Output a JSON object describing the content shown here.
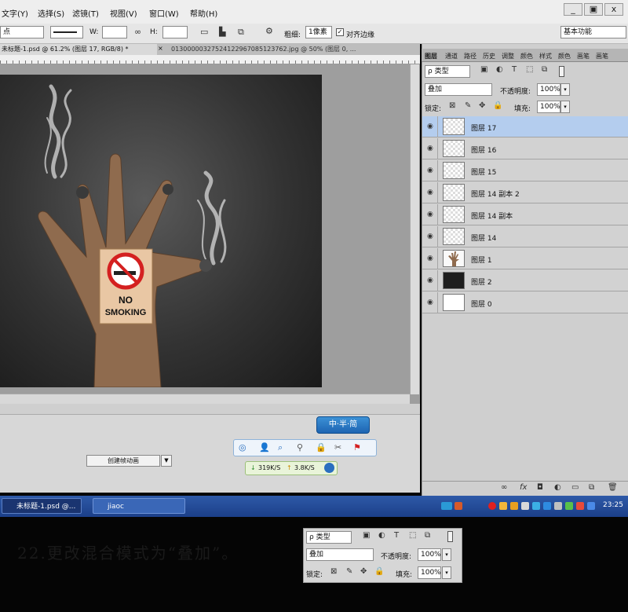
{
  "menu": {
    "items": [
      "文字(Y)",
      "选择(S)",
      "滤镜(T)",
      "视图(V)",
      "窗口(W)",
      "帮助(H)"
    ],
    "window_controls": [
      "_",
      "▣",
      "x"
    ]
  },
  "options_bar": {
    "unit_select": "点",
    "w_label": "W:",
    "h_label": "H:",
    "radius_label": "粗细:",
    "radius_value": "1像素",
    "align_edges_label": "对齐边缘",
    "workspace": "基本功能"
  },
  "tabs": {
    "active": "未标题-1.psd @ 61.2% (图层 17, RGB/8) *",
    "second": "0130000032752412296708512376​2.jpg @ 50% (图层 0, ..."
  },
  "timeline": {
    "create_label": "创建帧动画",
    "arrow": "▼"
  },
  "ime_label": "中·半·简",
  "netspeed": {
    "down": "319K/S",
    "up": "3.8K/S"
  },
  "panel": {
    "tabs": [
      "图层",
      "通道",
      "路径",
      "历史",
      "调整",
      "颜色",
      "样式",
      "颜色",
      "画笔",
      "画笔"
    ],
    "filter_label": "ρ 类型",
    "blend_mode": "叠加",
    "opacity_label": "不透明度:",
    "opacity_value": "100%",
    "lock_label": "锁定:",
    "fill_label": "填充:",
    "fill_value": "100%"
  },
  "layers": [
    {
      "name": "图层 17",
      "selected": true,
      "thumb": "transparent"
    },
    {
      "name": "图层 16",
      "selected": false,
      "thumb": "transparent"
    },
    {
      "name": "图层 15",
      "selected": false,
      "thumb": "transparent"
    },
    {
      "name": "图层 14 副本 2",
      "selected": false,
      "thumb": "transparent"
    },
    {
      "name": "图层 14 副本",
      "selected": false,
      "thumb": "transparent"
    },
    {
      "name": "图层 14",
      "selected": false,
      "thumb": "transparent"
    },
    {
      "name": "图层 1",
      "selected": false,
      "thumb": "hand"
    },
    {
      "name": "图层 2",
      "selected": false,
      "thumb": "dark"
    },
    {
      "name": "图层 0",
      "selected": false,
      "thumb": "white"
    }
  ],
  "sign": {
    "line1": "NO",
    "line2": "SMOKING"
  },
  "taskbar": {
    "task1": "未标题-1.psd @...",
    "task2": "jiaoc",
    "clock": "23:25"
  },
  "caption": "22.更改混合模式为“叠加”。",
  "zoom": {
    "filter_label": "ρ 类型",
    "blend_mode": "叠加",
    "opacity_label": "不透明度:",
    "opacity_value": "100%",
    "lock_label": "锁定:",
    "fill_label": "填充:",
    "fill_value": "100%"
  },
  "colors": {
    "selected_layer": "#b4cdee",
    "taskbar": "#1b3f88",
    "sign_red": "#d42020"
  }
}
